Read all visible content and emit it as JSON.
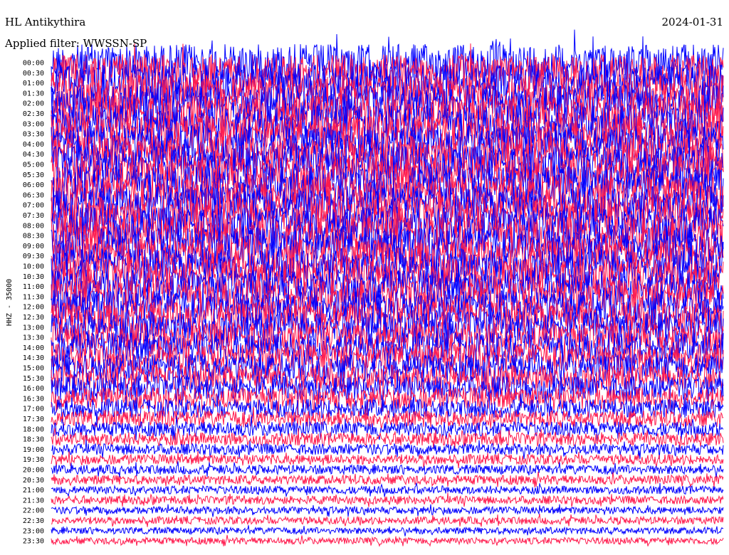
{
  "header": {
    "station": "HL Antikythira",
    "filter": "Applied filter: WWSSN-SP",
    "date": "2024-01-31"
  },
  "colors": {
    "trace_a": "#0000ff",
    "trace_b": "#ff1a4d",
    "background": "#ffffff",
    "text": "#000000"
  },
  "chart_data": {
    "type": "line",
    "subtype": "helicorder",
    "channel_label": "HHZ - 35000",
    "row_labels": [
      "00:00",
      "00:30",
      "01:00",
      "01:30",
      "02:00",
      "02:30",
      "03:00",
      "03:30",
      "04:00",
      "04:30",
      "05:00",
      "05:30",
      "06:00",
      "06:30",
      "07:00",
      "07:30",
      "08:00",
      "08:30",
      "09:00",
      "09:30",
      "10:00",
      "10:30",
      "11:00",
      "11:30",
      "12:00",
      "12:30",
      "13:00",
      "13:30",
      "14:00",
      "14:30",
      "15:00",
      "15:30",
      "16:00",
      "16:30",
      "17:00",
      "17:30",
      "18:00",
      "18:30",
      "19:00",
      "19:30",
      "20:00",
      "20:30",
      "21:00",
      "21:30",
      "22:00",
      "22:30",
      "23:00",
      "23:30"
    ],
    "row_duration_minutes": 30,
    "trace_colors_alternating": [
      "#0000ff",
      "#ff1a4d"
    ],
    "relative_amplitude": [
      1.0,
      1.0,
      1.0,
      1.0,
      1.0,
      1.0,
      1.0,
      1.0,
      1.0,
      1.0,
      1.0,
      1.0,
      1.0,
      1.0,
      1.0,
      1.0,
      1.0,
      1.0,
      1.0,
      0.95,
      0.95,
      0.95,
      0.9,
      0.9,
      0.9,
      0.85,
      0.85,
      0.8,
      0.8,
      0.75,
      0.75,
      0.7,
      0.65,
      0.6,
      0.5,
      0.45,
      0.4,
      0.35,
      0.3,
      0.27,
      0.25,
      0.25,
      0.22,
      0.22,
      0.2,
      0.2,
      0.18,
      0.18
    ],
    "grid": false
  }
}
